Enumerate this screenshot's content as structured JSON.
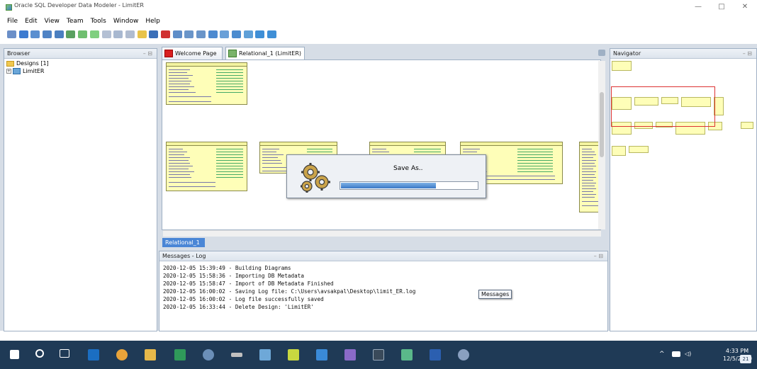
{
  "window": {
    "title": "Oracle SQL Developer Data Modeler - LimitER",
    "minimize": "—",
    "restore": "□",
    "close": "✕"
  },
  "menu": [
    "File",
    "Edit",
    "View",
    "Team",
    "Tools",
    "Window",
    "Help"
  ],
  "browser": {
    "title": "Browser",
    "designs": "Designs [1]",
    "design_name": "LimitER"
  },
  "tabs": [
    {
      "label": "Welcome Page"
    },
    {
      "label": "Relational_1 (LimitER)"
    }
  ],
  "diagram_tab": "Relational_1",
  "dialog": {
    "title": "Save As..",
    "progress": 0.7
  },
  "messages": {
    "title": "Messages - Log",
    "lines": [
      "2020-12-05 15:39:49 - Building Diagrams",
      "2020-12-05 15:58:36 - Importing DB Metadata",
      "2020-12-05 15:58:47 - Import of DB Metadata Finished",
      "2020-12-05 16:00:02 - Saving Log file: C:\\Users\\avsakpal\\Desktop\\limit_ER.log",
      "2020-12-05 16:00:02 - Log file successfully saved",
      "2020-12-05 16:33:44 - Delete Design: 'LimitER'"
    ],
    "tooltip": "Messages"
  },
  "navigator": {
    "title": "Navigator"
  },
  "taskbar": {
    "time": "4:33 PM",
    "date": "12/5/2020",
    "notifications": "21"
  },
  "colors": {
    "accent": "#4a86d6",
    "taskbar": "#1f3a56",
    "table_fill": "#fefeb8",
    "nav_highlight": "#dd3333"
  }
}
